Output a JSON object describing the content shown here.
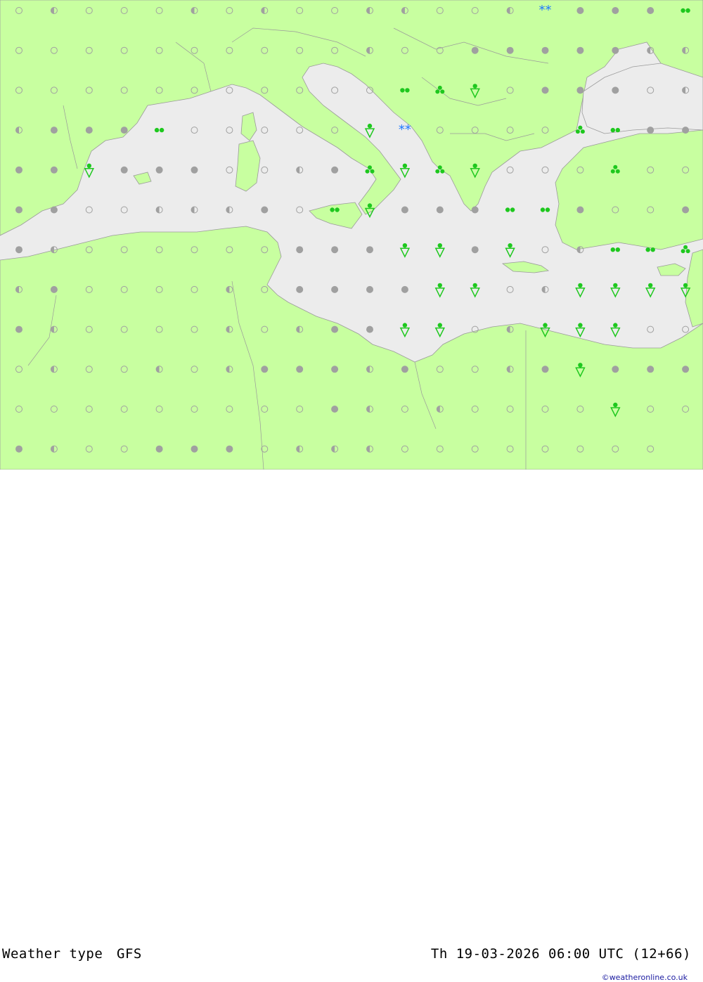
{
  "footer": {
    "title": "Weather type",
    "model": "GFS",
    "valid_time": "Th 19-03-2026 06:00 UTC (12+66)",
    "credit": "©weatheronline.co.uk"
  },
  "colors": {
    "land": "#c8ffa0",
    "sea": "#ececec",
    "border": "#9a9a9a",
    "rain": "#1ec81e",
    "snow": "#1e78ff",
    "cloud": "#a0a0a0"
  },
  "symbol_legend": {
    "clear": "open circle",
    "partly_cloudy": "half-filled circle",
    "overcast": "grey dot",
    "light_rain": "two green dots",
    "rain": "three green dots",
    "rain_shower": "green triangle with dot",
    "snow": "blue asterisks"
  },
  "grid": {
    "columns": 20,
    "rows": 12,
    "cells": [
      "ohooohohoohhooh?SgggR",
      "oooooooooohooggggghhoo",
      "oooooooooooR3Togggohgg",
      "hgggRoooooTSoooo3Rgg",
      "ggTgggoohg3T3ToooVooTRRgg",
      "ggoohhhgoRTgggRRgoogggT3gT3ggg",
      "ghoooooogggTTgTohRR3Rl3",
      "hgoooohoggggTTohTTTThT3",
      "ghoooohohggTTohTTTooTT",
      "ohoohohggghgoohgTgggo",
      "oooooooooghohooooToo",
      "ghoogggohhhoooooooo"
    ]
  }
}
